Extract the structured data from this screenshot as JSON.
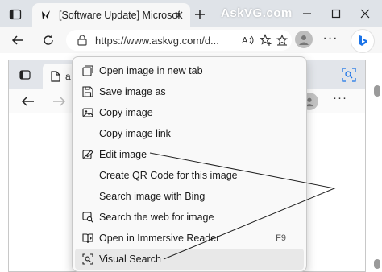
{
  "browser": {
    "tab_title": "[Software Update] Microsoft Edg",
    "watermark": "AskVG.com",
    "url": "https://www.askvg.com/d..."
  },
  "inner_browser": {
    "tab_label": "a"
  },
  "context_menu": {
    "items": [
      {
        "label": "Open image in new tab",
        "icon": "open-new-tab-icon",
        "shortcut": ""
      },
      {
        "label": "Save image as",
        "icon": "save-icon",
        "shortcut": ""
      },
      {
        "label": "Copy image",
        "icon": "image-copy-icon",
        "shortcut": ""
      },
      {
        "label": "Copy image link",
        "icon": "",
        "shortcut": ""
      },
      {
        "label": "Edit image",
        "icon": "edit-image-icon",
        "shortcut": ""
      },
      {
        "label": "Create QR Code for this image",
        "icon": "",
        "shortcut": ""
      },
      {
        "label": "Search image with Bing",
        "icon": "",
        "shortcut": ""
      },
      {
        "label": "Search the web for image",
        "icon": "search-web-image-icon",
        "shortcut": ""
      },
      {
        "label": "Open in Immersive Reader",
        "icon": "immersive-reader-icon",
        "shortcut": "F9"
      },
      {
        "label": "Visual Search",
        "icon": "visual-search-icon",
        "shortcut": ""
      }
    ],
    "highlighted": "Visual Search"
  },
  "colors": {
    "chrome": "#dfe3e8",
    "toolbar": "#f7f7f7",
    "menu": "#f9f9f9",
    "accent_bing": "#1a73e8"
  }
}
